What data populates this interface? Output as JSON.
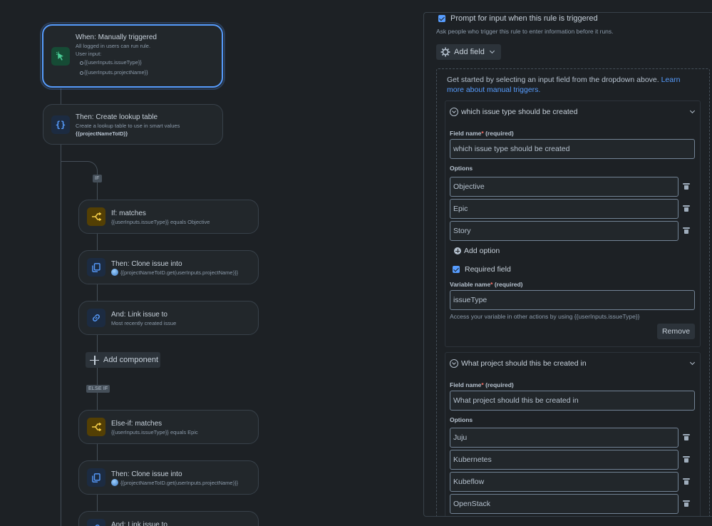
{
  "flow": {
    "trigger": {
      "title": "When: Manually triggered",
      "line1": "All logged in users can run rule.",
      "line2": "User input:",
      "inputs": [
        "{{userInputs.issueType}}",
        "{{userInputs.projectName}}"
      ]
    },
    "lookup": {
      "title": "Then: Create lookup table",
      "line1": "Create a lookup table to use in smart values",
      "line2": "{{projectNameToID}}"
    },
    "if_tag": "IF",
    "if_card": {
      "title": "If: matches",
      "sub": "{{userInputs.issueType}} equals Objective"
    },
    "clone1": {
      "title": "Then: Clone issue into",
      "sub": "{{projectNameToID.get(userInputs.projectName)}}"
    },
    "link1": {
      "title": "And: Link issue to",
      "sub": "Most recently created issue"
    },
    "add_component": "Add component",
    "elseif_tag": "ELSE IF",
    "elseif_card": {
      "title": "Else-if: matches",
      "sub": "{{userInputs.issueType}} equals Epic"
    },
    "clone2": {
      "title": "Then: Clone issue into",
      "sub": "{{projectNameToID.get(userInputs.projectName)}}"
    },
    "link2": {
      "title": "And: Link issue to"
    }
  },
  "panel": {
    "prompt_label": "Prompt for input when this rule is triggered",
    "prompt_help": "Ask people who trigger this rule to enter information before it runs.",
    "add_field": "Add field",
    "intro_text": "Get started by selecting an input field from the dropdown above. ",
    "intro_link": "Learn more about manual triggers.",
    "field1": {
      "header": "which issue type should be created",
      "field_name_label": "Field name",
      "required_suffix": " (required)",
      "field_name_value": "which issue type should be created",
      "options_label": "Options",
      "options": [
        "Objective",
        "Epic",
        "Story"
      ],
      "add_option": "Add option",
      "required_field": "Required field",
      "variable_label": "Variable name",
      "variable_value": "issueType",
      "variable_help": "Access your variable in other actions by using {{userInputs.issueType}}",
      "remove": "Remove"
    },
    "field2": {
      "header": "What project should this be created in",
      "field_name_label": "Field name",
      "required_suffix": " (required)",
      "field_name_value": "What project should this be created in",
      "options_label": "Options",
      "options": [
        "Juju",
        "Kubernetes",
        "Kubeflow",
        "OpenStack"
      ]
    }
  },
  "colors": {
    "background": "#1d2125",
    "card": "#22272b",
    "selected_border": "#579dff",
    "link": "#579dff",
    "required_star": "#f87168"
  }
}
